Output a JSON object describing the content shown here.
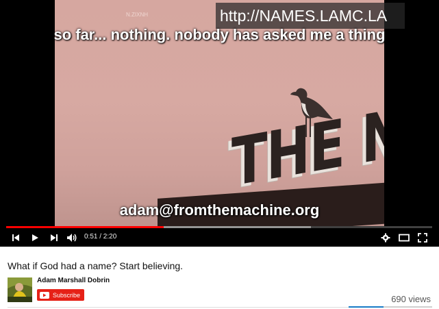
{
  "player": {
    "watermark": "N.ZIXNH",
    "url_overlay": "http://NAMES.LAMC.LA",
    "subtitle": "so far... nothing.  nobody has asked me a thing",
    "email_overlay": "adam@fromthemachine.org",
    "sign_letters": "THE N",
    "progress_played_fraction": 0.3705,
    "progress_buffered_fraction": 0.715,
    "time_display": "0:51 / 2:20",
    "accent_color": "#ff0000",
    "icons": {
      "previous": "skip-previous-icon",
      "play": "play-icon",
      "next": "skip-next-icon",
      "volume": "volume-icon",
      "settings": "gear-icon",
      "theater": "theater-mode-icon",
      "fullscreen": "fullscreen-icon"
    }
  },
  "video": {
    "title": "What if God had a name? Start believing.",
    "channel_name": "Adam Marshall Dobrin",
    "subscribe_label": "Subscribe",
    "views": "690 views",
    "subscribe_color": "#e62117",
    "like_bar_color": "#167ac6",
    "like_fraction": 0.42
  }
}
